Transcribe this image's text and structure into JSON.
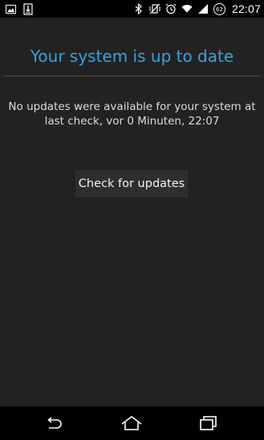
{
  "status_bar": {
    "time": "22:07",
    "battery_level": "62",
    "left_icons": [
      "image-notification-icon",
      "download-notification-icon"
    ],
    "right_icons": [
      "bluetooth-icon",
      "vibrate-icon",
      "alarm-icon",
      "wifi-icon",
      "signal-icon",
      "battery-icon"
    ]
  },
  "main": {
    "title": "Your system is up to date",
    "message": "No updates were available for your system at last check, vor 0 Minuten, 22:07",
    "check_button_label": "Check for updates"
  },
  "nav_bar": {
    "items": [
      "back-icon",
      "home-icon",
      "recent-apps-icon"
    ]
  },
  "colors": {
    "background": "#222222",
    "title": "#35a3e0",
    "status_bar": "#000000"
  }
}
